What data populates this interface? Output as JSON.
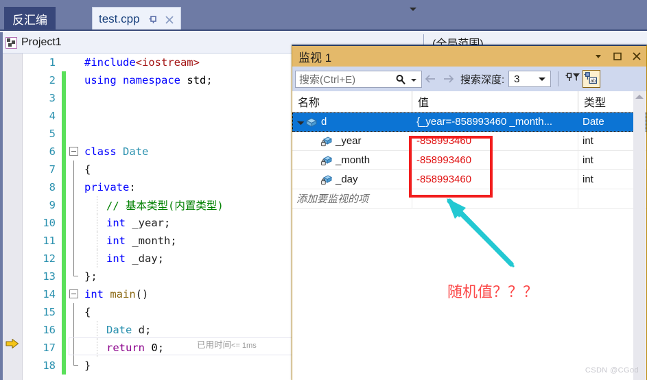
{
  "tabs": [
    {
      "label": "反汇编",
      "active": false,
      "name": "tab-disassembly"
    },
    {
      "label": "test.cpp",
      "active": true,
      "name": "tab-test-cpp"
    }
  ],
  "nav_bar": {
    "project": "Project1",
    "scope": "(全局范围)",
    "project_icon": "project-icon",
    "dropdown_icon": "chevron-down-icon"
  },
  "editor": {
    "execution_pointer_icon": "yellow-arrow-icon",
    "elapsed_label": "已用时间",
    "elapsed_value": "<= 1ms",
    "lines": [
      {
        "num": "1",
        "indent": 0,
        "segments": [
          {
            "t": "#include",
            "c": "k-blue"
          },
          {
            "t": "<iostream>",
            "c": "k-red"
          }
        ]
      },
      {
        "num": "2",
        "indent": 0,
        "segments": [
          {
            "t": "using",
            "c": "k-blue"
          },
          {
            "t": " ",
            "c": "k-plain"
          },
          {
            "t": "namespace",
            "c": "k-blue"
          },
          {
            "t": " ",
            "c": "k-plain"
          },
          {
            "t": "std",
            "c": "k-dark"
          },
          {
            "t": ";",
            "c": "k-plain"
          }
        ]
      },
      {
        "num": "3",
        "indent": 0,
        "segments": []
      },
      {
        "num": "4",
        "indent": 0,
        "segments": []
      },
      {
        "num": "5",
        "indent": 0,
        "segments": []
      },
      {
        "num": "6",
        "indent": 0,
        "segments": [
          {
            "t": "class",
            "c": "k-blue"
          },
          {
            "t": " ",
            "c": "k-plain"
          },
          {
            "t": "Date",
            "c": "k-teal"
          }
        ]
      },
      {
        "num": "7",
        "indent": 0,
        "segments": [
          {
            "t": "{",
            "c": "k-plain"
          }
        ]
      },
      {
        "num": "8",
        "indent": 0,
        "segments": [
          {
            "t": "private",
            "c": "k-blue"
          },
          {
            "t": ":",
            "c": "k-plain"
          }
        ]
      },
      {
        "num": "9",
        "indent": 1,
        "segments": [
          {
            "t": "// 基本类型(内置类型)",
            "c": "k-green"
          }
        ]
      },
      {
        "num": "10",
        "indent": 1,
        "segments": [
          {
            "t": "int",
            "c": "k-blue"
          },
          {
            "t": " _year;",
            "c": "k-plain"
          }
        ]
      },
      {
        "num": "11",
        "indent": 1,
        "segments": [
          {
            "t": "int",
            "c": "k-blue"
          },
          {
            "t": " _month;",
            "c": "k-plain"
          }
        ]
      },
      {
        "num": "12",
        "indent": 1,
        "segments": [
          {
            "t": "int",
            "c": "k-blue"
          },
          {
            "t": " _day;",
            "c": "k-plain"
          }
        ]
      },
      {
        "num": "13",
        "indent": 0,
        "segments": [
          {
            "t": "};",
            "c": "k-plain"
          }
        ]
      },
      {
        "num": "14",
        "indent": 0,
        "segments": [
          {
            "t": "int",
            "c": "k-blue"
          },
          {
            "t": " ",
            "c": "k-plain"
          },
          {
            "t": "main",
            "c": "k-brown"
          },
          {
            "t": "()",
            "c": "k-plain"
          }
        ]
      },
      {
        "num": "15",
        "indent": 0,
        "segments": [
          {
            "t": "{",
            "c": "k-plain"
          }
        ]
      },
      {
        "num": "16",
        "indent": 1,
        "segments": [
          {
            "t": "Date",
            "c": "k-teal"
          },
          {
            "t": " d;",
            "c": "k-plain"
          }
        ]
      },
      {
        "num": "17",
        "indent": 1,
        "segments": [
          {
            "t": "return",
            "c": "k-purple"
          },
          {
            "t": " ",
            "c": "k-plain"
          },
          {
            "t": "0",
            "c": "k-dark"
          },
          {
            "t": ";",
            "c": "k-plain"
          }
        ]
      },
      {
        "num": "18",
        "indent": 0,
        "segments": [
          {
            "t": "}",
            "c": "k-plain"
          }
        ]
      }
    ]
  },
  "watch": {
    "title": "监视 1",
    "titlebar_buttons": [
      {
        "name": "window-dropdown-icon"
      },
      {
        "name": "maximize-icon"
      },
      {
        "name": "close-icon"
      }
    ],
    "search_placeholder": "搜索(Ctrl+E)",
    "search_value": "",
    "search_icon": "search-icon",
    "search_dropdown_icon": "chevron-down-icon",
    "back_icon": "arrow-left-icon",
    "forward_icon": "arrow-right-icon",
    "depth_label": "搜索深度:",
    "depth_value": "3",
    "depth_dropdown_icon": "chevron-down-icon",
    "toolbar_icons": [
      {
        "name": "pin-filter-icon",
        "selected": false
      },
      {
        "name": "pin-ab-icon",
        "selected": true
      }
    ],
    "columns": [
      "名称",
      "值",
      "类型"
    ],
    "rows": [
      {
        "name": "d",
        "value": "{_year=-858993460 _month...",
        "type": "Date",
        "selected": true,
        "expanded": true,
        "level": 0,
        "icon": "object-cube-icon",
        "value_red": false
      },
      {
        "name": "_year",
        "value": "-858993460",
        "type": "int",
        "selected": false,
        "expanded": false,
        "level": 1,
        "icon": "private-field-icon",
        "value_red": true
      },
      {
        "name": "_month",
        "value": "-858993460",
        "type": "int",
        "selected": false,
        "expanded": false,
        "level": 1,
        "icon": "private-field-icon",
        "value_red": true
      },
      {
        "name": "_day",
        "value": "-858993460",
        "type": "int",
        "selected": false,
        "expanded": false,
        "level": 1,
        "icon": "private-field-icon",
        "value_red": true
      }
    ],
    "add_watch_placeholder": "添加要监视的项",
    "scroll_up_icon": "scroll-up-arrow-icon"
  },
  "annotation": {
    "text": "随机值？？？",
    "text_color": "#fb4a4a",
    "highlight_box_color": "#f21d1d",
    "arrow_color": "#23c8d2",
    "arrow_icon": "annotation-arrow-icon"
  },
  "watermark": "CSDN @CGod",
  "colors": {
    "tab_strip_bg": "#6e7ba5",
    "tab_active_bg": "#eef2fb",
    "tab_inactive_bg": "#38477a",
    "watch_title_bg": "#e4b96a",
    "watch_toolbar_bg": "#cfd8ee",
    "selection_blue": "#0c74d4",
    "changebar_green": "#5ae05a"
  }
}
